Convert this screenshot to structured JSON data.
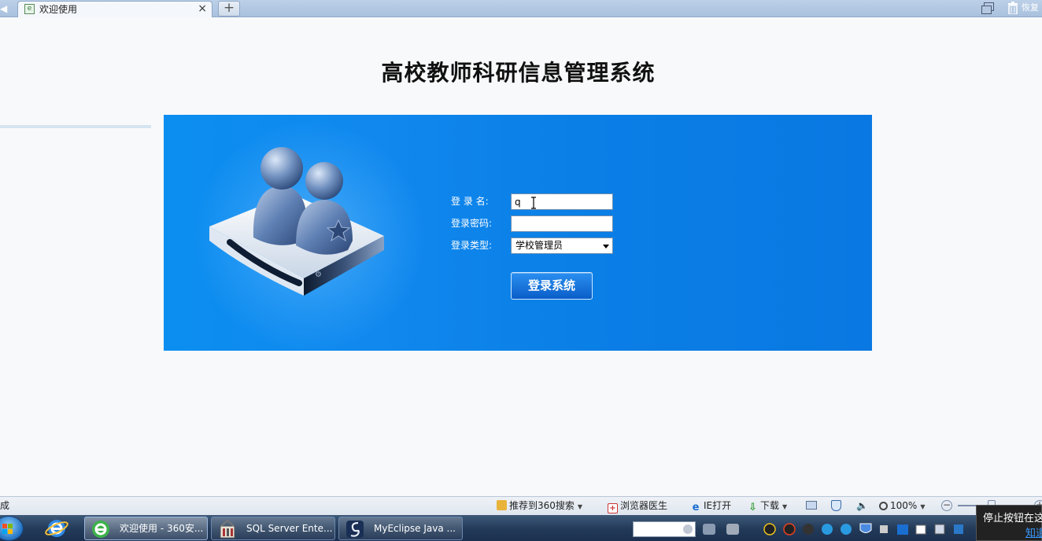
{
  "browser": {
    "tab_title": "欢迎使用",
    "close_glyph": "×",
    "new_tab_glyph": "+",
    "restore_label": "恢复"
  },
  "page": {
    "title": "高校教师科研信息管理系统",
    "form": {
      "username_label": "登 录 名:",
      "username_value": "q",
      "password_label": "登录密码:",
      "password_value": "",
      "type_label": "登录类型:",
      "type_selected": "学校管理员",
      "submit_label": "登录系统"
    }
  },
  "statusbar": {
    "status_text": "成",
    "recommend_360": "推荐到360搜索",
    "browser_doctor": "浏览器医生",
    "ie_open": "IE打开",
    "download": "下载",
    "zoom": "100%"
  },
  "taskbar": {
    "tasks": [
      {
        "label": "欢迎使用 - 360安..."
      },
      {
        "label": "SQL Server Ente..."
      },
      {
        "label": "MyEclipse Java ..."
      }
    ],
    "tooltip_text": "停止按钮在这",
    "tooltip_link": "知道"
  },
  "colors": {
    "panel_blue": "#0a82ea",
    "button_blue": "#0a5ec8",
    "taskbar": "#223a58"
  }
}
